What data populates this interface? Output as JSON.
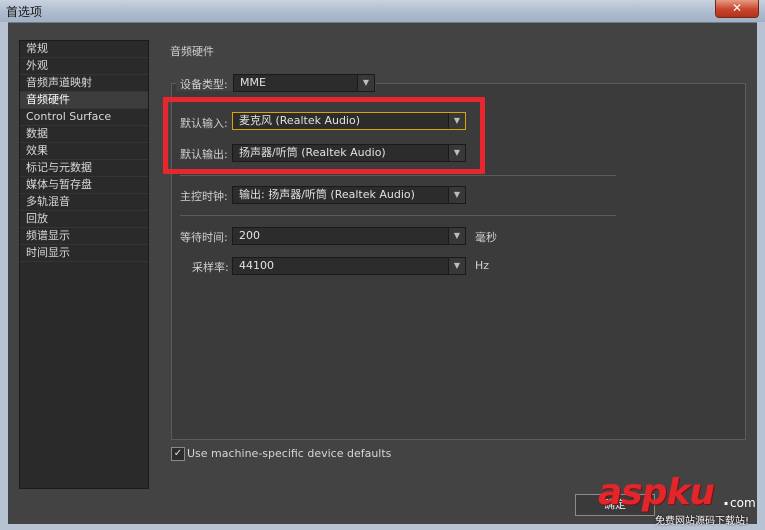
{
  "window": {
    "title": "首选项",
    "close_glyph": "✕"
  },
  "sidebar": {
    "items": [
      {
        "label": "常规"
      },
      {
        "label": "外观"
      },
      {
        "label": "音频声道映射"
      },
      {
        "label": "音频硬件",
        "selected": true
      },
      {
        "label": "Control Surface"
      },
      {
        "label": "数据"
      },
      {
        "label": "效果"
      },
      {
        "label": "标记与元数据"
      },
      {
        "label": "媒体与暂存盘"
      },
      {
        "label": "多轨混音"
      },
      {
        "label": "回放"
      },
      {
        "label": "频谱显示"
      },
      {
        "label": "时间显示"
      }
    ]
  },
  "panel": {
    "title": "音频硬件",
    "device_type": {
      "label": "设备类型:",
      "value": "MME"
    },
    "default_input": {
      "label": "默认输入:",
      "value": "麦克风 (Realtek Audio)"
    },
    "default_output": {
      "label": "默认输出:",
      "value": "扬声器/听筒 (Realtek Audio)"
    },
    "master_clock": {
      "label": "主控时钟:",
      "value": "输出: 扬声器/听筒 (Realtek Audio)"
    },
    "latency": {
      "label": "等待时间:",
      "value": "200",
      "unit": "毫秒"
    },
    "sample_rate": {
      "label": "采样率:",
      "value": "44100",
      "unit": "Hz"
    }
  },
  "checkbox": {
    "label": "Use machine-specific device defaults",
    "checked": true,
    "mark": "✓"
  },
  "footer": {
    "ok_partial": "确定"
  },
  "watermark": {
    "logo": "aspku",
    "dot": ".",
    "com": "com",
    "slogan": "免费网站源码下载站!"
  },
  "icons": {
    "dropdown_arrow": "▼"
  },
  "colors": {
    "highlight": "#e8262d",
    "focus": "#d9a600",
    "background": "#434343"
  }
}
